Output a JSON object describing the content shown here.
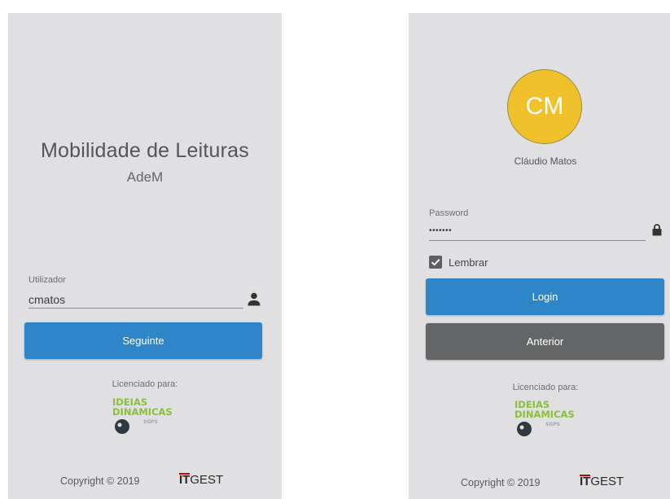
{
  "left": {
    "app_title": "Mobilidade de Leituras",
    "app_subtitle": "AdeM",
    "username_label": "Utilizador",
    "username_value": "cmatos",
    "username_icon": "person-icon",
    "next_button": "Seguinte",
    "licensed_label": "Licenciado para:",
    "logo": {
      "line1": "IDEIAS",
      "line2": "DINAMICAS",
      "line3": "SGPS"
    },
    "copyright": "Copyright © 2019",
    "brand": {
      "bold": "IT",
      "rest": "GEST"
    }
  },
  "right": {
    "avatar_initials": "CM",
    "user_name": "Cláudio Matos",
    "password_label": "Password",
    "password_value": "•••••••",
    "password_icon": "lock-icon",
    "remember_label": "Lembrar",
    "remember_checked": true,
    "login_button": "Login",
    "previous_button": "Anterior",
    "licensed_label": "Licenciado para:",
    "logo": {
      "line1": "IDEIAS",
      "line2": "DINAMICAS",
      "line3": "SGPS"
    },
    "copyright": "Copyright © 2019",
    "brand": {
      "bold": "IT",
      "rest": "GEST"
    }
  },
  "colors": {
    "screen_bg": "#e0e0e2",
    "primary_button": "#2e86c8",
    "secondary_button": "#636567",
    "avatar_bg": "#efc12a",
    "logo_green": "#8bbf3a"
  }
}
